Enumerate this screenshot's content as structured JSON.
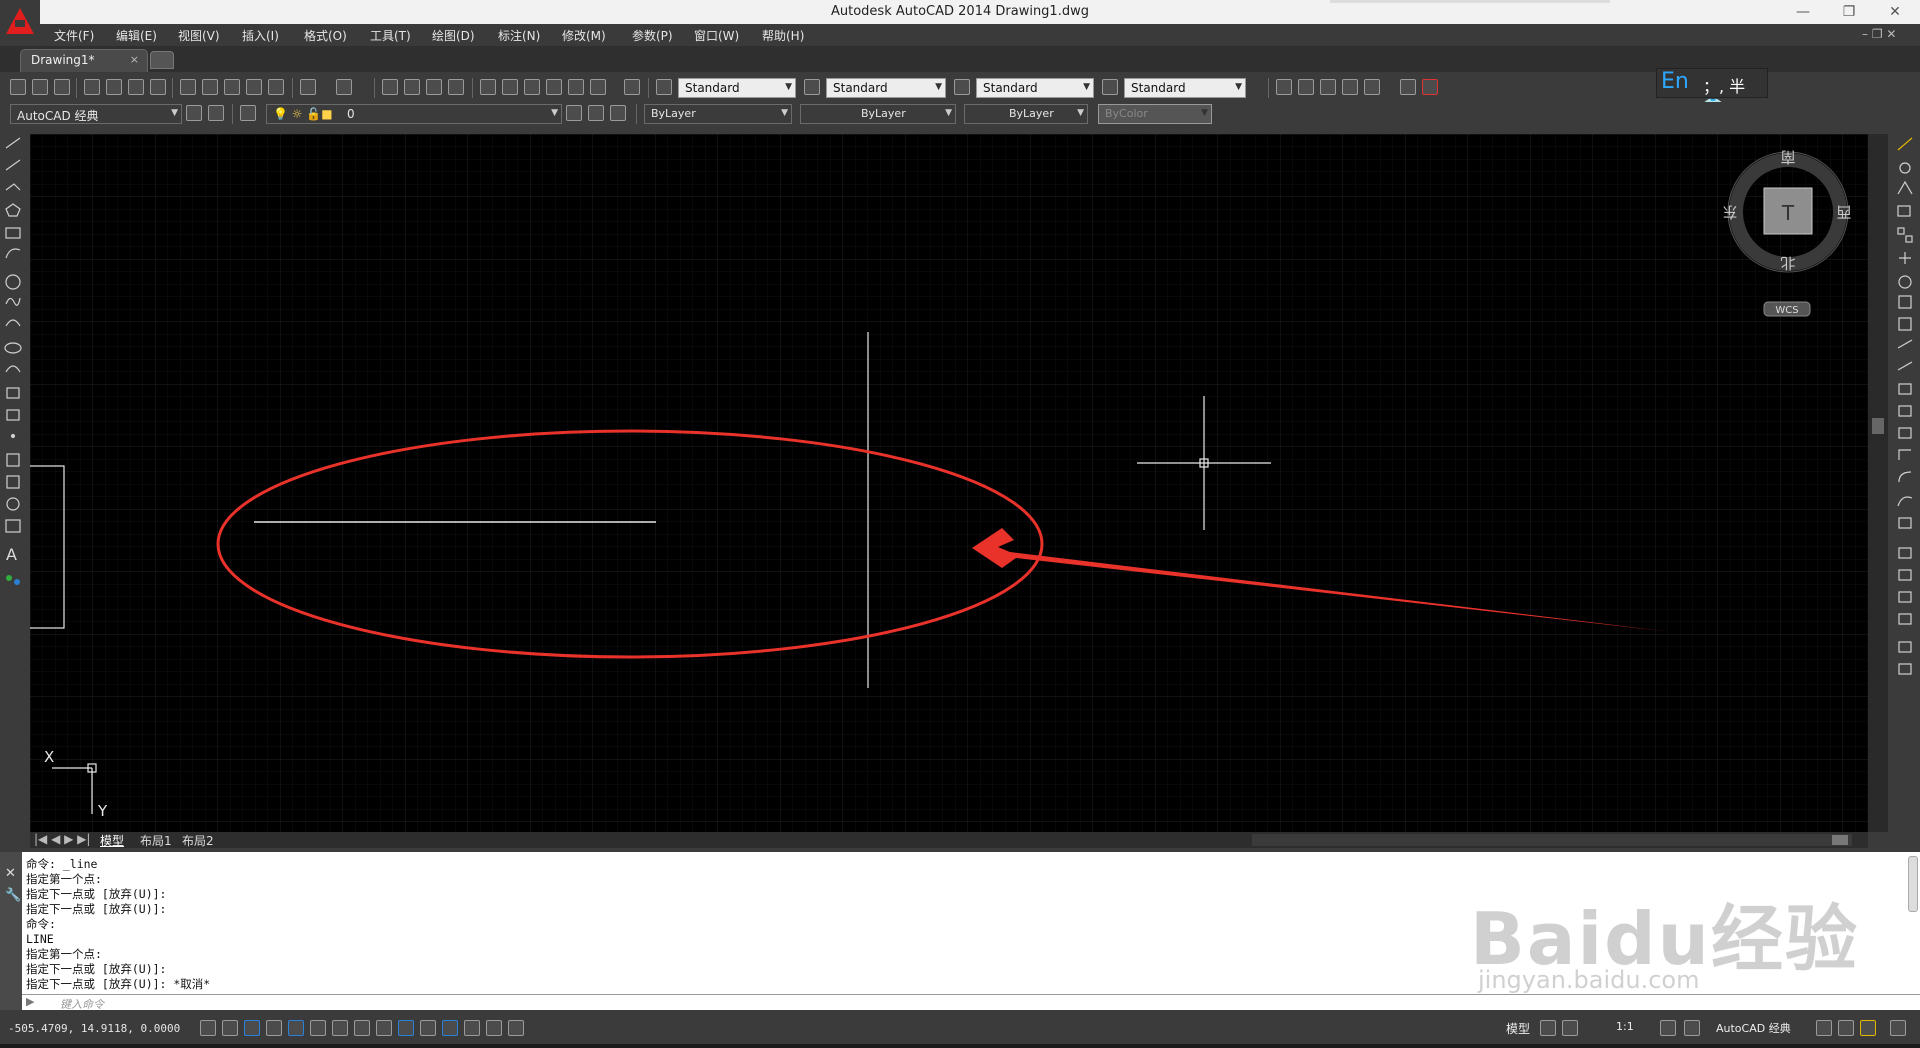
{
  "window": {
    "title": "Autodesk AutoCAD 2014    Drawing1.dwg"
  },
  "menu": [
    "文件(F)",
    "编辑(E)",
    "视图(V)",
    "插入(I)",
    "格式(O)",
    "工具(T)",
    "绘图(D)",
    "标注(N)",
    "修改(M)",
    "参数(P)",
    "窗口(W)",
    "帮助(H)"
  ],
  "doc_tab": {
    "label": "Drawing1*",
    "close": "×"
  },
  "styles_toolbar": {
    "text_style": "Standard",
    "dim_style": "Standard",
    "table_style": "Standard",
    "multileader_style": "Standard"
  },
  "ime": {
    "lang": "En",
    "rest": "；, 半 👕"
  },
  "layers_toolbar": {
    "workspace": "AutoCAD 经典",
    "layer": "0",
    "color": "ByLayer",
    "linetype": "ByLayer",
    "lineweight": "ByLayer",
    "plotstyle": "ByColor"
  },
  "viewcube": {
    "north": "北",
    "south": "南",
    "east": "东",
    "west": "西",
    "top_face": "T",
    "wcs": "WCS"
  },
  "ucs": {
    "x": "X",
    "y": "Y"
  },
  "layout_tabs": [
    "模型",
    "布局1",
    "布局2"
  ],
  "command_history": [
    "命令: _line",
    "指定第一个点:",
    "指定下一点或 [放弃(U)]:",
    "指定下一点或 [放弃(U)]:",
    "命令:",
    "LINE",
    "指定第一个点:",
    "指定下一点或 [放弃(U)]:",
    "指定下一点或 [放弃(U)]: *取消*"
  ],
  "command_input": {
    "placeholder": "键入命令"
  },
  "status": {
    "coords": "-505.4709, 14.9118, 0.0000",
    "model": "模型",
    "scale": "1:1",
    "workspace": "AutoCAD 经典"
  },
  "watermark": {
    "text": "Baidu经验",
    "url": "jingyan.baidu.com"
  },
  "colors": {
    "annotation": "#e8322a",
    "canvas": "#000000",
    "grid": "#1a1a22"
  }
}
